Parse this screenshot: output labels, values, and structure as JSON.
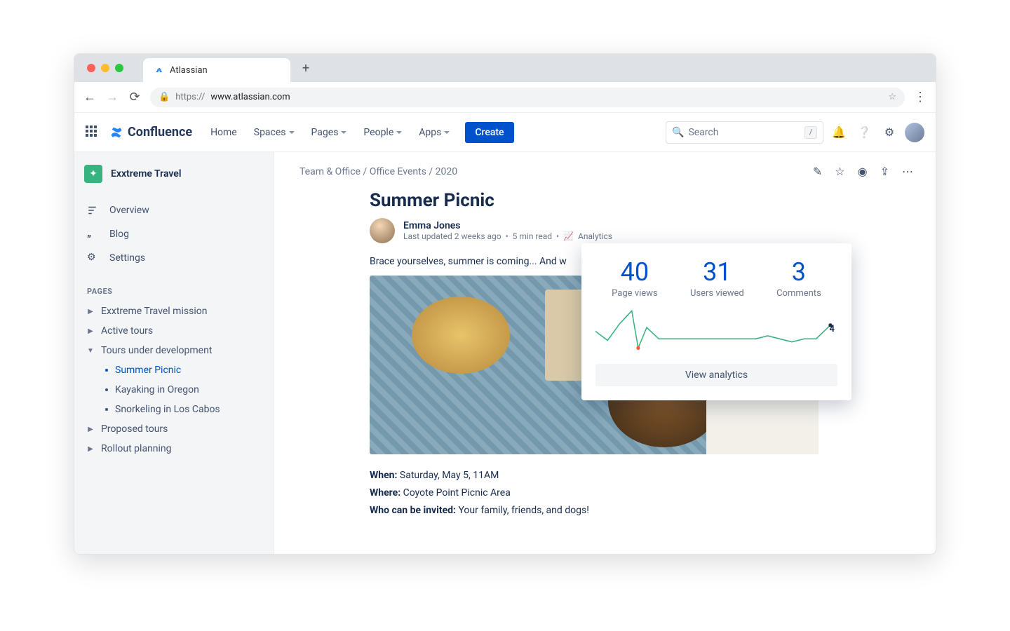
{
  "browser": {
    "tab_title": "Atlassian",
    "url_scheme": "https://",
    "url_host": "www.atlassian.com"
  },
  "appbar": {
    "product": "Confluence",
    "links": {
      "home": "Home",
      "spaces": "Spaces",
      "pages": "Pages",
      "people": "People",
      "apps": "Apps"
    },
    "create": "Create",
    "search_placeholder": "Search",
    "search_hint": "/"
  },
  "sidebar": {
    "space": "Exxtreme Travel",
    "overview": "Overview",
    "blog": "Blog",
    "settings": "Settings",
    "section": "PAGES",
    "tree": {
      "mission": "Exxtreme Travel mission",
      "active": "Active tours",
      "dev": "Tours under development",
      "dev_children": {
        "picnic": "Summer Picnic",
        "kayak": "Kayaking in Oregon",
        "snorkel": "Snorkeling in Los Cabos"
      },
      "proposed": "Proposed tours",
      "rollout": "Rollout planning"
    }
  },
  "page": {
    "breadcrumbs": "Team & Office / Office Events / 2020",
    "title": "Summer Picnic",
    "author": "Emma Jones",
    "updated": "Last updated 2 weeks ago",
    "readtime": "5 min read",
    "analytics_label": "Analytics",
    "intro": "Brace yourselves, summer is coming... And w",
    "when_label": "When:",
    "when_value": " Saturday, May 5, 11AM",
    "where_label": "Where:",
    "where_value": " Coyote Point Picnic Area",
    "who_label": "Who can be invited:",
    "who_value": " Your family, friends, and dogs!"
  },
  "popover": {
    "views_val": "40",
    "views_lbl": "Page views",
    "users_val": "31",
    "users_lbl": "Users viewed",
    "comments_val": "3",
    "comments_lbl": "Comments",
    "end_value": "4",
    "button": "View analytics"
  },
  "chart_data": {
    "type": "line",
    "title": "Page views over time (sparkline)",
    "x": [
      0,
      1,
      2,
      3,
      4,
      5,
      6,
      7,
      8,
      9,
      10,
      11,
      12,
      13,
      14,
      15,
      16,
      17,
      18,
      19,
      20
    ],
    "values": [
      6,
      3,
      7,
      18,
      2,
      8,
      4,
      4,
      4,
      4,
      4,
      4,
      4,
      4,
      4,
      5,
      4,
      3,
      4,
      4,
      7
    ],
    "end_label": 4,
    "ylim": [
      0,
      20
    ]
  }
}
